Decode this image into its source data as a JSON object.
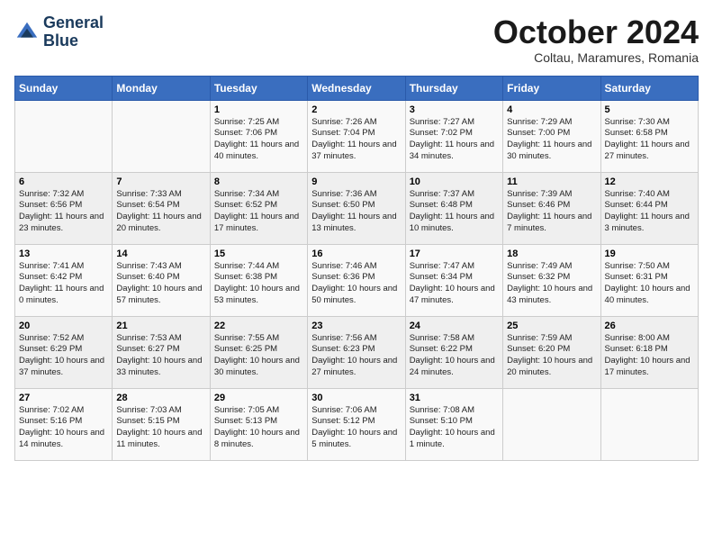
{
  "header": {
    "logo_line1": "General",
    "logo_line2": "Blue",
    "month": "October 2024",
    "location": "Coltau, Maramures, Romania"
  },
  "weekdays": [
    "Sunday",
    "Monday",
    "Tuesday",
    "Wednesday",
    "Thursday",
    "Friday",
    "Saturday"
  ],
  "weeks": [
    [
      {
        "day": "",
        "info": ""
      },
      {
        "day": "",
        "info": ""
      },
      {
        "day": "1",
        "info": "Sunrise: 7:25 AM\nSunset: 7:06 PM\nDaylight: 11 hours and 40 minutes."
      },
      {
        "day": "2",
        "info": "Sunrise: 7:26 AM\nSunset: 7:04 PM\nDaylight: 11 hours and 37 minutes."
      },
      {
        "day": "3",
        "info": "Sunrise: 7:27 AM\nSunset: 7:02 PM\nDaylight: 11 hours and 34 minutes."
      },
      {
        "day": "4",
        "info": "Sunrise: 7:29 AM\nSunset: 7:00 PM\nDaylight: 11 hours and 30 minutes."
      },
      {
        "day": "5",
        "info": "Sunrise: 7:30 AM\nSunset: 6:58 PM\nDaylight: 11 hours and 27 minutes."
      }
    ],
    [
      {
        "day": "6",
        "info": "Sunrise: 7:32 AM\nSunset: 6:56 PM\nDaylight: 11 hours and 23 minutes."
      },
      {
        "day": "7",
        "info": "Sunrise: 7:33 AM\nSunset: 6:54 PM\nDaylight: 11 hours and 20 minutes."
      },
      {
        "day": "8",
        "info": "Sunrise: 7:34 AM\nSunset: 6:52 PM\nDaylight: 11 hours and 17 minutes."
      },
      {
        "day": "9",
        "info": "Sunrise: 7:36 AM\nSunset: 6:50 PM\nDaylight: 11 hours and 13 minutes."
      },
      {
        "day": "10",
        "info": "Sunrise: 7:37 AM\nSunset: 6:48 PM\nDaylight: 11 hours and 10 minutes."
      },
      {
        "day": "11",
        "info": "Sunrise: 7:39 AM\nSunset: 6:46 PM\nDaylight: 11 hours and 7 minutes."
      },
      {
        "day": "12",
        "info": "Sunrise: 7:40 AM\nSunset: 6:44 PM\nDaylight: 11 hours and 3 minutes."
      }
    ],
    [
      {
        "day": "13",
        "info": "Sunrise: 7:41 AM\nSunset: 6:42 PM\nDaylight: 11 hours and 0 minutes."
      },
      {
        "day": "14",
        "info": "Sunrise: 7:43 AM\nSunset: 6:40 PM\nDaylight: 10 hours and 57 minutes."
      },
      {
        "day": "15",
        "info": "Sunrise: 7:44 AM\nSunset: 6:38 PM\nDaylight: 10 hours and 53 minutes."
      },
      {
        "day": "16",
        "info": "Sunrise: 7:46 AM\nSunset: 6:36 PM\nDaylight: 10 hours and 50 minutes."
      },
      {
        "day": "17",
        "info": "Sunrise: 7:47 AM\nSunset: 6:34 PM\nDaylight: 10 hours and 47 minutes."
      },
      {
        "day": "18",
        "info": "Sunrise: 7:49 AM\nSunset: 6:32 PM\nDaylight: 10 hours and 43 minutes."
      },
      {
        "day": "19",
        "info": "Sunrise: 7:50 AM\nSunset: 6:31 PM\nDaylight: 10 hours and 40 minutes."
      }
    ],
    [
      {
        "day": "20",
        "info": "Sunrise: 7:52 AM\nSunset: 6:29 PM\nDaylight: 10 hours and 37 minutes."
      },
      {
        "day": "21",
        "info": "Sunrise: 7:53 AM\nSunset: 6:27 PM\nDaylight: 10 hours and 33 minutes."
      },
      {
        "day": "22",
        "info": "Sunrise: 7:55 AM\nSunset: 6:25 PM\nDaylight: 10 hours and 30 minutes."
      },
      {
        "day": "23",
        "info": "Sunrise: 7:56 AM\nSunset: 6:23 PM\nDaylight: 10 hours and 27 minutes."
      },
      {
        "day": "24",
        "info": "Sunrise: 7:58 AM\nSunset: 6:22 PM\nDaylight: 10 hours and 24 minutes."
      },
      {
        "day": "25",
        "info": "Sunrise: 7:59 AM\nSunset: 6:20 PM\nDaylight: 10 hours and 20 minutes."
      },
      {
        "day": "26",
        "info": "Sunrise: 8:00 AM\nSunset: 6:18 PM\nDaylight: 10 hours and 17 minutes."
      }
    ],
    [
      {
        "day": "27",
        "info": "Sunrise: 7:02 AM\nSunset: 5:16 PM\nDaylight: 10 hours and 14 minutes."
      },
      {
        "day": "28",
        "info": "Sunrise: 7:03 AM\nSunset: 5:15 PM\nDaylight: 10 hours and 11 minutes."
      },
      {
        "day": "29",
        "info": "Sunrise: 7:05 AM\nSunset: 5:13 PM\nDaylight: 10 hours and 8 minutes."
      },
      {
        "day": "30",
        "info": "Sunrise: 7:06 AM\nSunset: 5:12 PM\nDaylight: 10 hours and 5 minutes."
      },
      {
        "day": "31",
        "info": "Sunrise: 7:08 AM\nSunset: 5:10 PM\nDaylight: 10 hours and 1 minute."
      },
      {
        "day": "",
        "info": ""
      },
      {
        "day": "",
        "info": ""
      }
    ]
  ]
}
